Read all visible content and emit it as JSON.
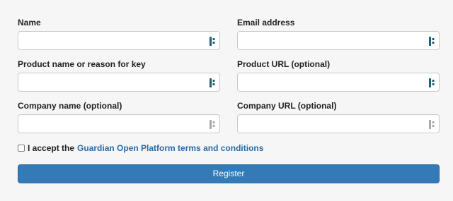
{
  "fields": [
    {
      "label": "Name",
      "value": "",
      "icon": "password-manager-icon",
      "icon_color": "#1e5f72"
    },
    {
      "label": "Email address",
      "value": "",
      "icon": "password-manager-icon",
      "icon_color": "#1e5f72"
    },
    {
      "label": "Product name or reason for key",
      "value": "",
      "icon": "password-manager-icon",
      "icon_color": "#1e5f72"
    },
    {
      "label": "Product URL (optional)",
      "value": "",
      "icon": "password-manager-icon",
      "icon_color": "#1e5f72"
    },
    {
      "label": "Company name (optional)",
      "value": "",
      "icon": "password-manager-icon",
      "icon_color": "#a8a8a8"
    },
    {
      "label": "Company URL (optional)",
      "value": "",
      "icon": "password-manager-icon",
      "icon_color": "#a8a8a8"
    }
  ],
  "consent": {
    "checked": false,
    "prefix": "I accept the",
    "link_text": "Guardian Open Platform terms and conditions"
  },
  "register": {
    "label": "Register",
    "color": "#337ab7"
  }
}
